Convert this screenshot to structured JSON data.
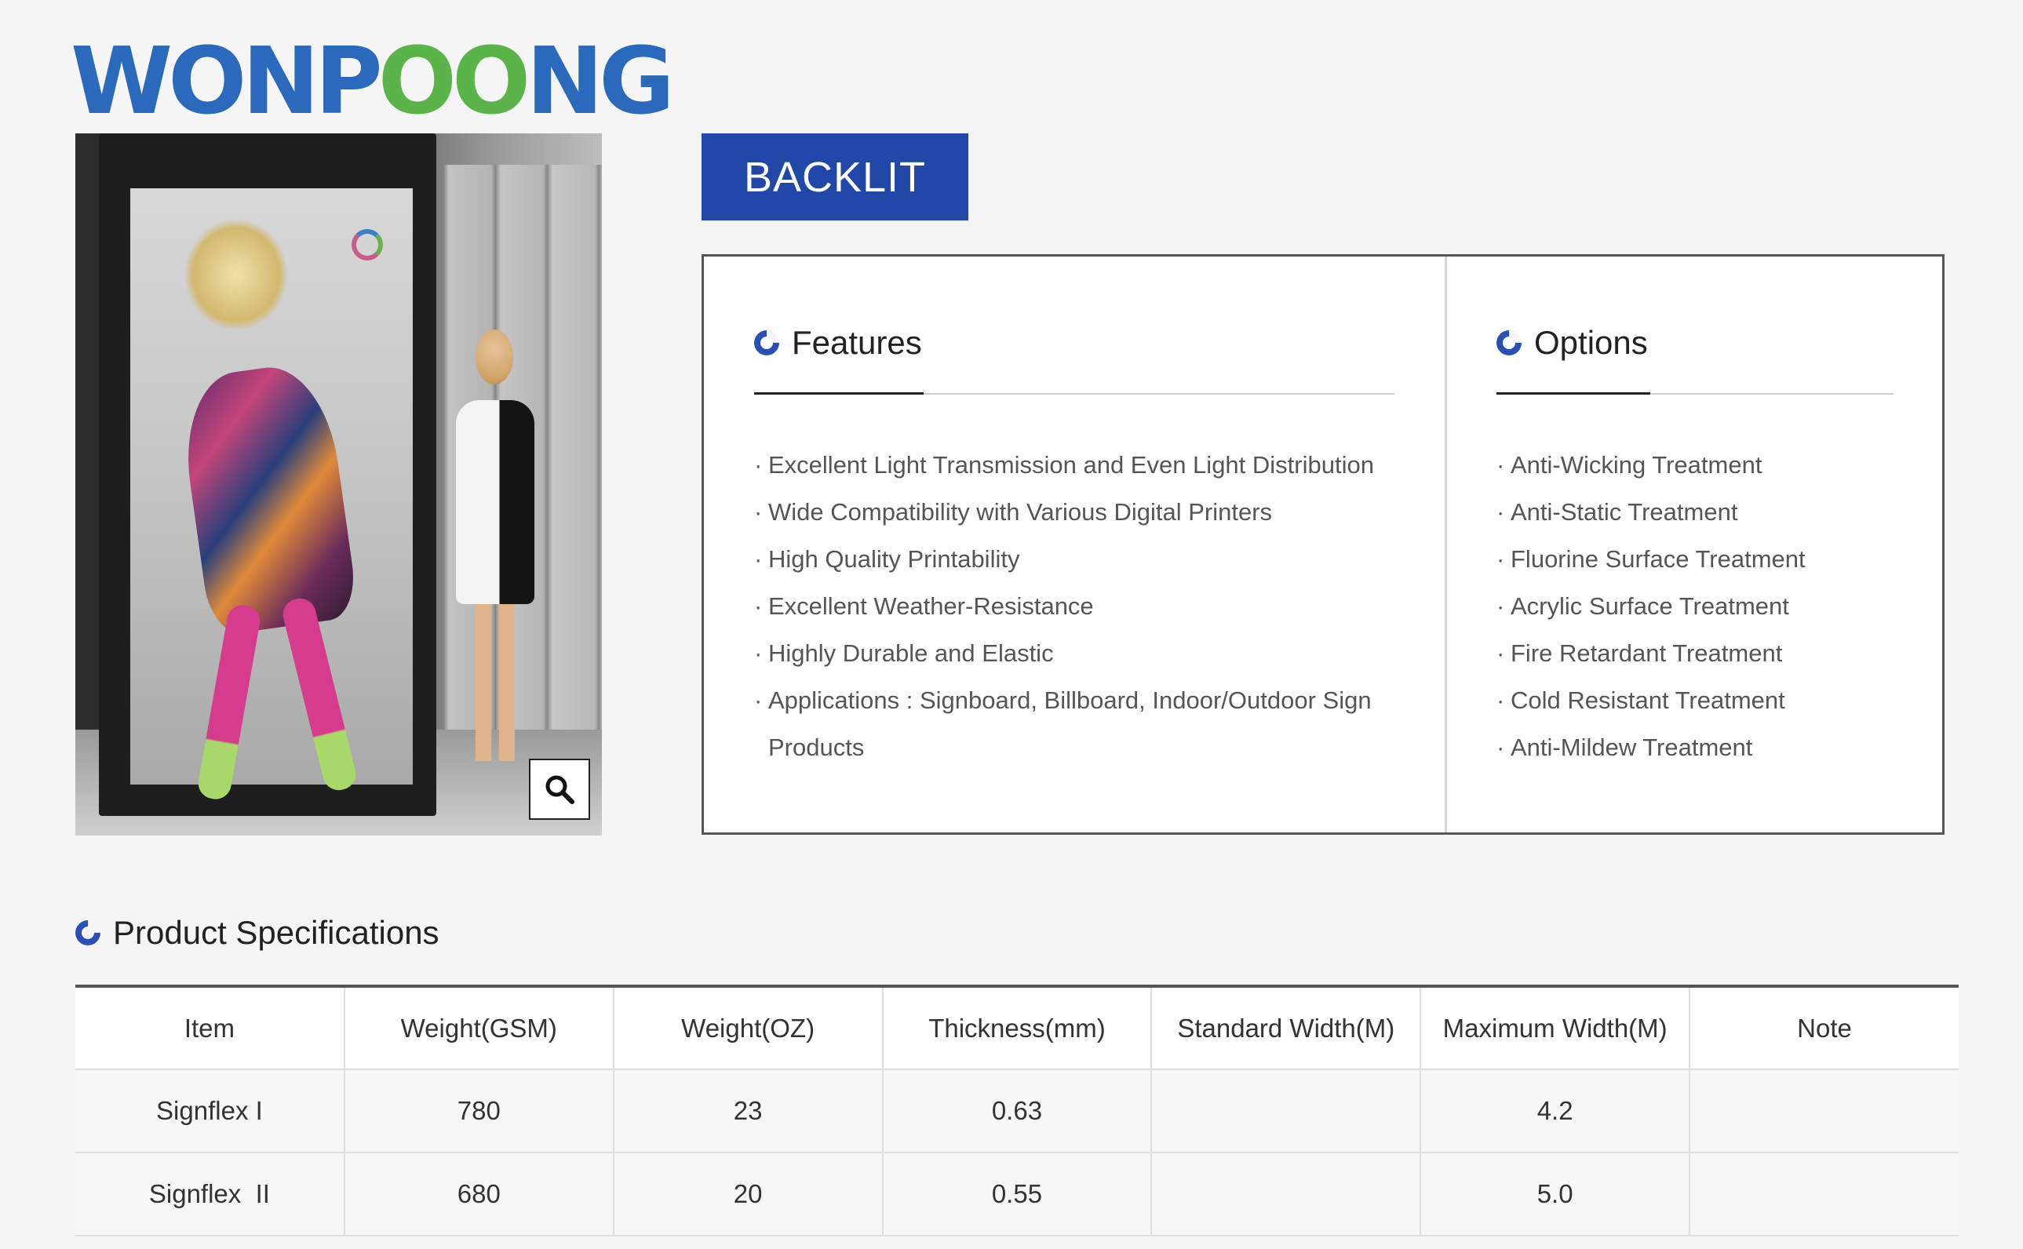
{
  "brand": {
    "logo_part1": "WONP",
    "logo_part2": "OO",
    "logo_part3": "NG",
    "colors": {
      "blue": "#2a69bb",
      "green": "#5bb449",
      "badge": "#2147a8"
    }
  },
  "product": {
    "title": "BACKLIT",
    "image_icon": "zoom-icon"
  },
  "features": {
    "heading": "Features",
    "items": [
      "Excellent Light Transmission and Even Light Distribution",
      "Wide Compatibility with Various Digital Printers",
      "High Quality Printability",
      "Excellent Weather-Resistance",
      "Highly Durable and Elastic",
      "Applications : Signboard, Billboard, Indoor/Outdoor Sign",
      "Products"
    ]
  },
  "options": {
    "heading": "Options",
    "items": [
      "Anti-Wicking Treatment",
      "Anti-Static Treatment",
      "Fluorine Surface Treatment",
      "Acrylic Surface Treatment",
      "Fire Retardant Treatment",
      "Cold Resistant Treatment",
      "Anti-Mildew Treatment"
    ]
  },
  "specs": {
    "heading": "Product Specifications",
    "columns": [
      "Item",
      "Weight(GSM)",
      "Weight(OZ)",
      "Thickness(mm)",
      "Standard Width(M)",
      "Maximum Width(M)",
      "Note"
    ],
    "rows": [
      [
        "Signflex I",
        "780",
        "23",
        "0.63",
        "",
        "4.2",
        ""
      ],
      [
        "Signflex  II",
        "680",
        "20",
        "0.55",
        "",
        "5.0",
        ""
      ]
    ]
  }
}
